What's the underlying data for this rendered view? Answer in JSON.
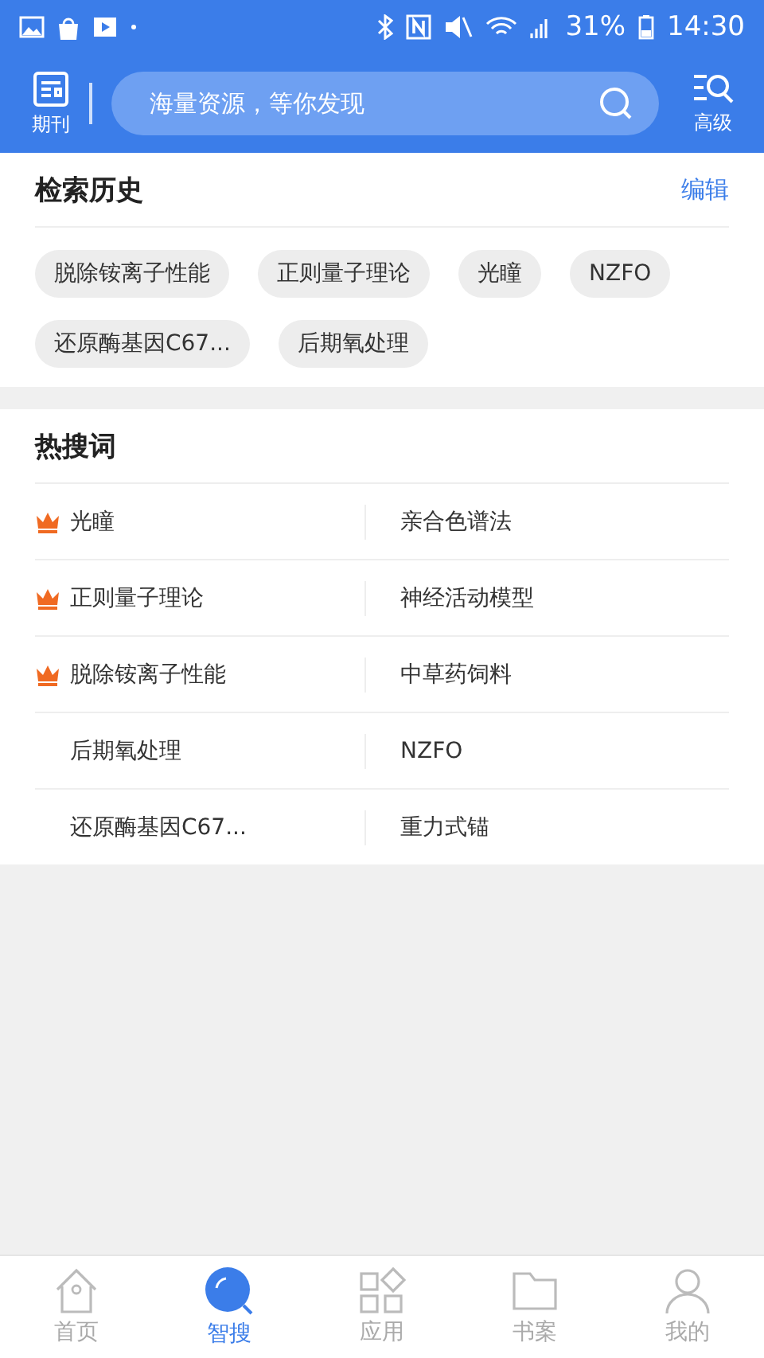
{
  "status_bar": {
    "battery": "31%",
    "time": "14:30"
  },
  "header": {
    "left_label": "期刊",
    "search_placeholder": "海量资源，等你发现",
    "right_label": "高级"
  },
  "history": {
    "title": "检索历史",
    "action": "编辑",
    "tags": [
      "脱除铵离子性能",
      "正则量子理论",
      "光瞳",
      "NZFO",
      "还原酶基因C67...",
      "后期氧处理"
    ]
  },
  "hot": {
    "title": "热搜词",
    "rows": [
      {
        "left": "光瞳",
        "left_hot": true,
        "right": "亲合色谱法"
      },
      {
        "left": "正则量子理论",
        "left_hot": true,
        "right": "神经活动模型"
      },
      {
        "left": "脱除铵离子性能",
        "left_hot": true,
        "right": "中草药饲料"
      },
      {
        "left": "后期氧处理",
        "left_hot": false,
        "right": "NZFO"
      },
      {
        "left": "还原酶基因C67...",
        "left_hot": false,
        "right": "重力式锚"
      }
    ]
  },
  "nav": [
    {
      "label": "首页",
      "kind": "home",
      "selected": false
    },
    {
      "label": "智搜",
      "kind": "search",
      "selected": true
    },
    {
      "label": "应用",
      "kind": "apps",
      "selected": false
    },
    {
      "label": "书案",
      "kind": "folder",
      "selected": false
    },
    {
      "label": "我的",
      "kind": "user",
      "selected": false
    }
  ]
}
